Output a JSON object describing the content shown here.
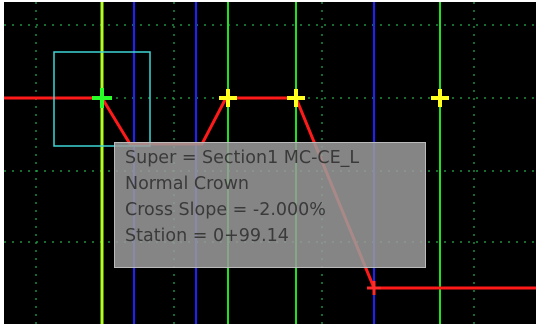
{
  "viewport": {
    "background": "#000000",
    "grid_color": "#22b14c",
    "alignment_line_color": "#ff1a1a",
    "selection_box_color": "#3fd5d5",
    "vertical_line_colors": {
      "blue": "#2020ff",
      "green": "#20e020",
      "yellow_green": "#b0ff20"
    },
    "point_colors": {
      "active": "#28ff28",
      "key": "#ffff20",
      "end": "#ff2a2a"
    },
    "icons": [
      "plus-marker-icon"
    ]
  },
  "tooltip": {
    "lines": [
      "Super = Section1  MC-CE_L",
      "Normal Crown",
      "Cross Slope = -2.000%",
      "Station = 0+99.14"
    ]
  }
}
